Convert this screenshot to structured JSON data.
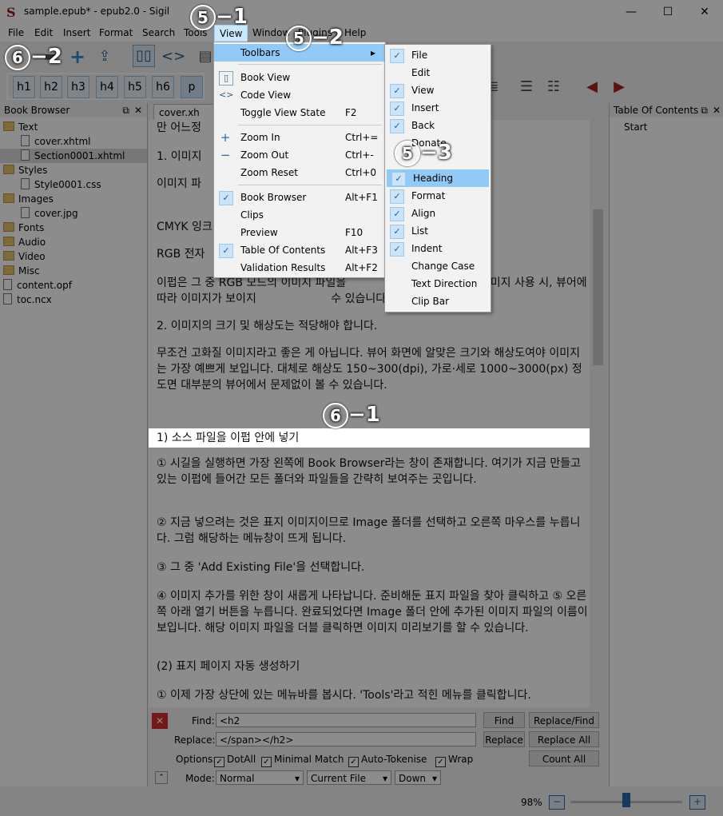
{
  "window": {
    "title": "sample.epub* - epub2.0 - Sigil",
    "minimize": "—",
    "maximize": "☐",
    "close": "✕"
  },
  "menubar": [
    "File",
    "Edit",
    "Insert",
    "Format",
    "Search",
    "Tools",
    "View",
    "Window",
    "Plugins",
    "Help"
  ],
  "heading_buttons": [
    "h1",
    "h2",
    "h3",
    "h4",
    "h5",
    "h6",
    "p"
  ],
  "book_browser": {
    "title": "Book Browser",
    "items": [
      {
        "label": "Text",
        "type": "folder",
        "level": 0
      },
      {
        "label": "cover.xhtml",
        "type": "file",
        "level": 1
      },
      {
        "label": "Section0001.xhtml",
        "type": "file",
        "level": 1
      },
      {
        "label": "Styles",
        "type": "folder",
        "level": 0
      },
      {
        "label": "Style0001.css",
        "type": "file",
        "level": 1
      },
      {
        "label": "Images",
        "type": "folder",
        "level": 0
      },
      {
        "label": "cover.jpg",
        "type": "file",
        "level": 1
      },
      {
        "label": "Fonts",
        "type": "folder",
        "level": 0
      },
      {
        "label": "Audio",
        "type": "folder",
        "level": 0
      },
      {
        "label": "Video",
        "type": "folder",
        "level": 0
      },
      {
        "label": "Misc",
        "type": "folder",
        "level": 0
      },
      {
        "label": "content.opf",
        "type": "file",
        "level": 0
      },
      {
        "label": "toc.ncx",
        "type": "file",
        "level": 0
      }
    ]
  },
  "editor": {
    "tab": "cover.xh",
    "paragraphs": [
      "만 어느정",
      "1. 이미지",
      "이미지 파                                               하자면 다음과 같습니다.",
      "CMYK 잉크",
      "RGB 전자",
      "이펍은 그 중 RGB 모드의 이미지 파일을                     CMYK 모드 이미지 사용 시, 뷰어에 따라 이미지가 보이지                     수 있습니다.",
      "2. 이미지의 크기 및 해상도는 적당해야 합니다.",
      "무조건 고화질 이미지라고 좋은 게 아닙니다. 뷰어 화면에 알맞은 크기와 해상도여야 이미지는 가장 예쁘게 보입니다. 대체로 해상도 150~300(dpi), 가로·세로 1000~3000(px) 정도면 대부분의 뷰어에서 문제없이 볼 수 있습니다.",
      "1) 소스 파일을 이펍 안에 넣기",
      "① 시길을 실행하면 가장 왼쪽에 Book Browser라는 창이 존재합니다. 여기가 지금 만들고 있는 이펍에 들어간 모든 폴더와 파일들을 간략히 보여주는 곳입니다.",
      "② 지금 넣으려는 것은 표지 이미지이므로 Image 폴더를 선택하고 오른쪽 마우스를 누릅니다. 그럼 해당하는 메뉴창이 뜨게 됩니다.",
      "③ 그 중 'Add Existing File'을 선택합니다.",
      "④ 이미지 추가를 위한 창이 새롭게 나타납니다. 준비해둔 표지 파일을 찾아 클릭하고 ⑤ 오른쪽 아래 열기 버튼을 누릅니다. 완료되었다면 Image 폴더 안에 추가된 이미지 파일의 이름이 보입니다. 해당 이미지 파일을 더블 클릭하면 이미지 미리보기를 할 수 있습니다.",
      "(2) 표지 페이지 자동 생성하기",
      "① 이제 가장 상단에 있는 메뉴바를 봅시다. 'Tools'라고 적힌 메뉴를 클릭합니다."
    ]
  },
  "toc": {
    "title": "Table Of Contents",
    "items": [
      "Start"
    ]
  },
  "find_replace": {
    "find_label": "Find:",
    "find_value": "<h2",
    "replace_label": "Replace:",
    "replace_value": "</span></h2>",
    "options_label": "Options:",
    "options": [
      "DotAll",
      "Minimal Match",
      "Auto-Tokenise",
      "Wrap"
    ],
    "mode_label": "Mode:",
    "mode": "Normal",
    "scope": "Current File",
    "direction": "Down",
    "buttons": {
      "find": "Find",
      "replace_find": "Replace/Find",
      "replace": "Replace",
      "replace_all": "Replace All",
      "count_all": "Count All"
    }
  },
  "status": {
    "zoom": "98%",
    "zoom_level": 0.5
  },
  "view_menu": {
    "items": [
      {
        "label": "Toolbars",
        "shortcut": "▸",
        "checked": false,
        "highlight": true
      },
      {
        "label": "Book View",
        "shortcut": "",
        "checked": false
      },
      {
        "label": "Code View",
        "shortcut": "",
        "checked": false
      },
      {
        "label": "Toggle View State",
        "shortcut": "F2",
        "checked": false
      },
      {
        "label": "Zoom In",
        "shortcut": "Ctrl+=",
        "checked": false
      },
      {
        "label": "Zoom Out",
        "shortcut": "Ctrl+-",
        "checked": false
      },
      {
        "label": "Zoom Reset",
        "shortcut": "Ctrl+0",
        "checked": false
      },
      {
        "label": "Book Browser",
        "shortcut": "Alt+F1",
        "checked": true
      },
      {
        "label": "Clips",
        "shortcut": "",
        "checked": false
      },
      {
        "label": "Preview",
        "shortcut": "F10",
        "checked": false
      },
      {
        "label": "Table Of Contents",
        "shortcut": "Alt+F3",
        "checked": true
      },
      {
        "label": "Validation Results",
        "shortcut": "Alt+F2",
        "checked": false
      }
    ]
  },
  "toolbars_submenu": {
    "items": [
      {
        "label": "File",
        "checked": true
      },
      {
        "label": "Edit",
        "checked": false
      },
      {
        "label": "View",
        "checked": true
      },
      {
        "label": "Insert",
        "checked": true
      },
      {
        "label": "Back",
        "checked": true
      },
      {
        "label": "Donate",
        "checked": false
      },
      {
        "label": "Heading",
        "checked": true,
        "highlight": true
      },
      {
        "label": "Format",
        "checked": true
      },
      {
        "label": "Align",
        "checked": true
      },
      {
        "label": "List",
        "checked": true
      },
      {
        "label": "Indent",
        "checked": true
      },
      {
        "label": "Change Case",
        "checked": false
      },
      {
        "label": "Text Direction",
        "checked": false
      },
      {
        "label": "Clip Bar",
        "checked": false
      }
    ]
  },
  "annotations": [
    "⑤−1",
    "⑤−2",
    "⑤−3",
    "⑥−1",
    "⑥−2"
  ]
}
